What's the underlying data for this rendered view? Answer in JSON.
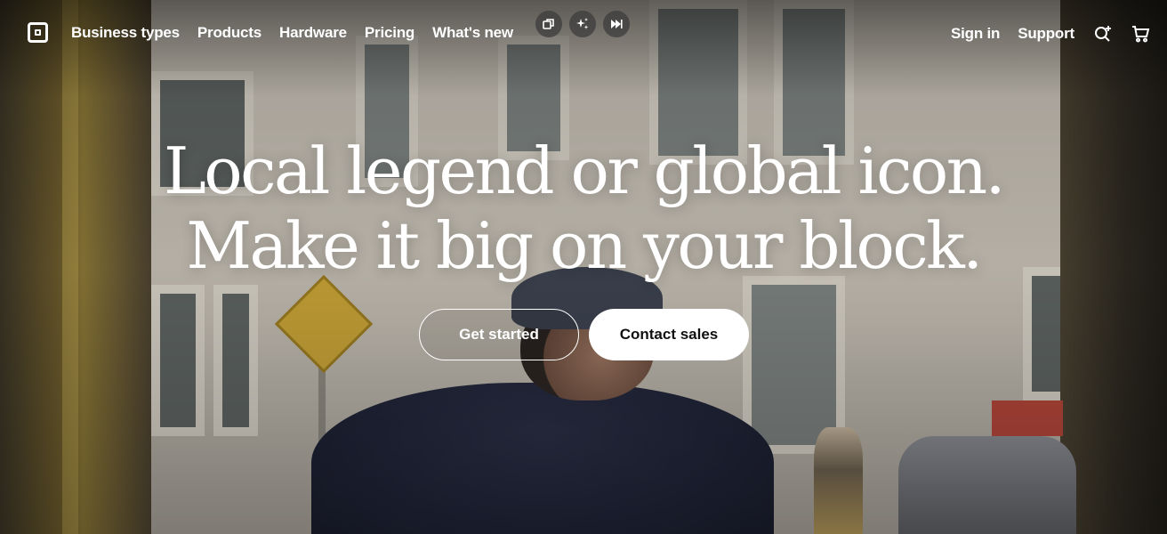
{
  "nav": {
    "logo_icon": "square-logo-icon",
    "links": [
      "Business types",
      "Products",
      "Hardware",
      "Pricing",
      "What's new"
    ],
    "media_controls": [
      {
        "icon": "picture-in-picture-icon",
        "glyph": "⧉"
      },
      {
        "icon": "sparkle-icon",
        "glyph": "✦"
      },
      {
        "icon": "skip-forward-icon",
        "glyph": "⏭"
      }
    ],
    "sign_in": "Sign in",
    "support": "Support",
    "search_icon": "search-sparkle-icon",
    "cart_icon": "cart-icon"
  },
  "hero": {
    "headline_line1": "Local legend or global icon.",
    "headline_line2": "Make it big on your block.",
    "cta_primary": "Get started",
    "cta_secondary": "Contact sales"
  },
  "colors": {
    "text": "#ffffff",
    "button_solid_bg": "#ffffff",
    "button_solid_text": "#111111"
  }
}
